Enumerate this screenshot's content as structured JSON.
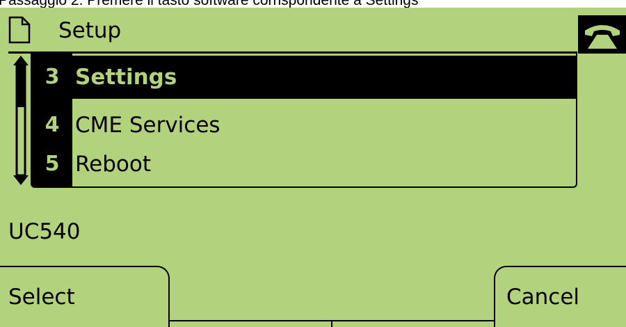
{
  "caption": "Passaggio 2. Premere il tasto software corrispondente a Settings",
  "header": {
    "title": "Setup",
    "icon": "document-icon",
    "status_icon": "phone-handset-icon"
  },
  "menu": {
    "items": [
      {
        "number": "3",
        "label": "Settings",
        "selected": true
      },
      {
        "number": "4",
        "label": "CME Services",
        "selected": false
      },
      {
        "number": "5",
        "label": "Reboot",
        "selected": false
      }
    ]
  },
  "status": {
    "text": "UC540"
  },
  "softkeys": {
    "left": "Select",
    "right": "Cancel"
  },
  "colors": {
    "lcd_background": "#b3d27e",
    "foreground": "#000000"
  }
}
